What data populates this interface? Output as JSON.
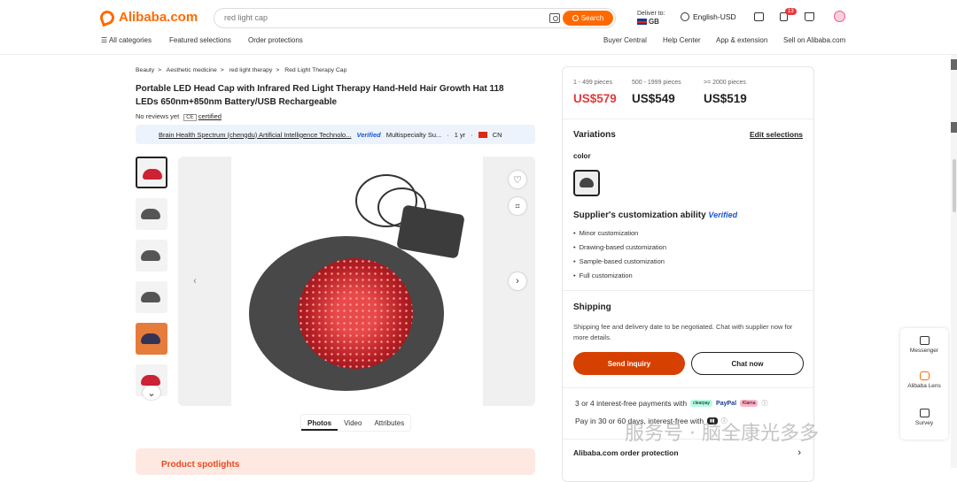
{
  "header": {
    "logo": "Alibaba.com",
    "search_placeholder": "red light cap",
    "search_button": "Search",
    "deliver_label": "Deliver to:",
    "deliver_country": "GB",
    "language": "English-USD",
    "cart_badge": "13"
  },
  "nav": {
    "all_categories": "All categories",
    "featured": "Featured selections",
    "protections": "Order protections",
    "buyer_central": "Buyer Central",
    "help_center": "Help Center",
    "app": "App & extension",
    "sell": "Sell on Alibaba.com"
  },
  "breadcrumb": [
    "Beauty",
    ">",
    "Aesthetic medicine",
    ">",
    "red light therapy",
    ">",
    "Red Light Therapy Cap"
  ],
  "product": {
    "title": "Portable LED Head Cap with Infrared Red Light Therapy Hand-Held Hair Growth Hat 118 LEDs 650nm+850nm Battery/USB Rechargeable",
    "no_reviews": "No reviews yet",
    "cert_badge": "CE",
    "certified": "certified"
  },
  "supplier": {
    "name": "Brain Health Spectrum (chengdu) Artificial Intelligence Technolo...",
    "verified": "Verified",
    "type": "Multispecialty Su...",
    "years": "1 yr",
    "country": "CN"
  },
  "media_tabs": [
    "Photos",
    "Video",
    "Attributes"
  ],
  "spotlight": "Product spotlights",
  "pricing": [
    {
      "tier": "1 - 499 pieces",
      "price": "US$579"
    },
    {
      "tier": "500 - 1999 pieces",
      "price": "US$549"
    },
    {
      "tier": ">= 2000 pieces",
      "price": "US$519"
    }
  ],
  "variations": {
    "title": "Variations",
    "edit": "Edit selections",
    "color_label": "color"
  },
  "customization": {
    "title": "Supplier's customization ability",
    "verified": "Verified",
    "items": [
      "Minor customization",
      "Drawing-based customization",
      "Sample-based customization",
      "Full customization"
    ]
  },
  "shipping": {
    "title": "Shipping",
    "text": "Shipping fee and delivery date to be negotiated. Chat with supplier now for more details."
  },
  "actions": {
    "send_inquiry": "Send inquiry",
    "chat_now": "Chat now"
  },
  "payments": {
    "line1": "3 or 4 interest-free payments with",
    "line2": "Pay in 30 or 60 days, interest-free with",
    "methods": [
      "clearpay",
      "PayPal",
      "Klarna"
    ]
  },
  "order_protection": "Alibaba.com order protection",
  "floating": {
    "messenger": "Messenger",
    "lens": "Alibaba Lens",
    "survey": "Survey"
  },
  "watermark": "服务号 · 脑全康光多多"
}
